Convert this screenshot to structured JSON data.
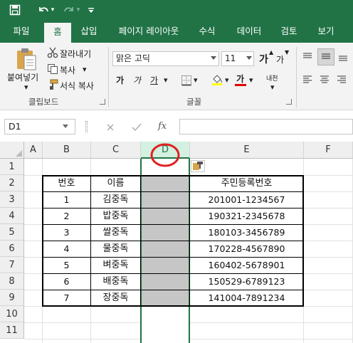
{
  "quick_access": {
    "save_icon": "save-icon",
    "undo_icon": "undo-icon",
    "redo_icon": "redo-icon",
    "customize_icon": "customize-qat-icon"
  },
  "tabs": [
    {
      "label": "파일",
      "active": false
    },
    {
      "label": "홈",
      "active": true
    },
    {
      "label": "삽입",
      "active": false
    },
    {
      "label": "페이지 레이아웃",
      "active": false
    },
    {
      "label": "수식",
      "active": false
    },
    {
      "label": "데이터",
      "active": false
    },
    {
      "label": "검토",
      "active": false
    },
    {
      "label": "보기",
      "active": false
    }
  ],
  "clipboard": {
    "paste_label": "붙여넣기",
    "cut_label": "잘라내기",
    "copy_label": "복사",
    "format_painter_label": "서식 복사",
    "group_label": "클립보드"
  },
  "font": {
    "font_name": "맑은 고딕",
    "font_size": "11",
    "increase_label": "가",
    "decrease_label": "가",
    "bold_label": "가",
    "italic_label": "가",
    "underline_label": "가",
    "font_color_label": "가",
    "phonetic_label": "내천",
    "group_label": "글꼴"
  },
  "formula_bar": {
    "name_box": "D1",
    "cancel_icon": "x-icon",
    "enter_icon": "check-icon",
    "fx_label": "fx",
    "value": ""
  },
  "grid": {
    "columns": [
      "A",
      "B",
      "C",
      "D",
      "E",
      "F"
    ],
    "selected_column": "D",
    "rows": [
      "1",
      "2",
      "3",
      "4",
      "5",
      "6",
      "7",
      "8",
      "9",
      "10",
      "11"
    ],
    "headers": {
      "num": "번호",
      "name": "이름",
      "rrn": "주민등록번호"
    },
    "records": [
      {
        "num": "1",
        "name": "김중독",
        "rrn": "201001-1234567"
      },
      {
        "num": "2",
        "name": "밥중독",
        "rrn": "190321-2345678"
      },
      {
        "num": "3",
        "name": "쌀중독",
        "rrn": "180103-3456789"
      },
      {
        "num": "4",
        "name": "물중독",
        "rrn": "170228-4567890"
      },
      {
        "num": "5",
        "name": "벼중독",
        "rrn": "160402-5678901"
      },
      {
        "num": "6",
        "name": "배중독",
        "rrn": "150529-6789123"
      },
      {
        "num": "7",
        "name": "장중독",
        "rrn": "141004-7891234"
      }
    ]
  },
  "colors": {
    "accent": "#217346",
    "selection_fill": "#c6c6c6",
    "highlight_circle": "#e02020"
  }
}
